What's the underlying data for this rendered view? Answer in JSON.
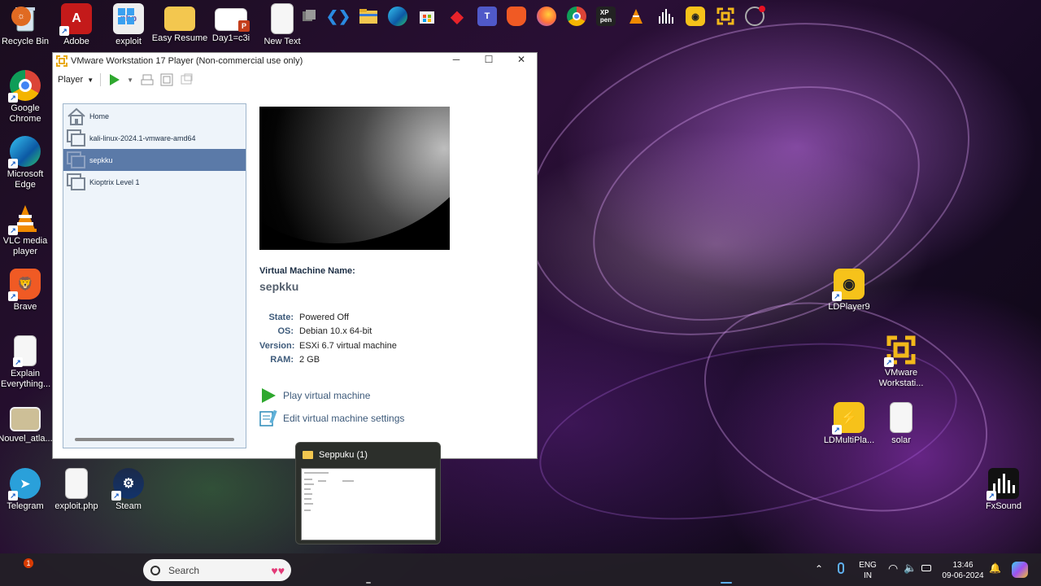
{
  "desktop": {
    "icons_left": [
      {
        "label": "Recycle Bin",
        "icon": "recycle-bin-icon"
      },
      {
        "label": "Adobe",
        "icon": "adobe-icon"
      },
      {
        "label": "exploit",
        "icon": "php-file-icon"
      },
      {
        "label": "Easy Resume",
        "icon": "folder-icon"
      },
      {
        "label": "Day1=c3i",
        "icon": "powerpoint-file-icon"
      },
      {
        "label": "New Text",
        "icon": "text-file-icon"
      },
      {
        "label": "Google Chrome",
        "icon": "chrome-icon"
      },
      {
        "label": "Microsoft Edge",
        "icon": "edge-icon"
      },
      {
        "label": "VLC media player",
        "icon": "vlc-icon"
      },
      {
        "label": "Brave",
        "icon": "brave-icon"
      },
      {
        "label": "Explain Everything...",
        "icon": "text-file-icon"
      },
      {
        "label": "Nouvel_atla...",
        "icon": "image-file-icon"
      },
      {
        "label": "Telegram",
        "icon": "telegram-icon"
      },
      {
        "label": "exploit.php",
        "icon": "text-file-icon"
      },
      {
        "label": "Steam",
        "icon": "steam-icon"
      }
    ],
    "icons_right": [
      {
        "label": "LDPlayer9",
        "icon": "ldplayer-icon"
      },
      {
        "label": "VMware Workstati...",
        "icon": "vmware-icon"
      },
      {
        "label": "LDMultiPla...",
        "icon": "ldmultiplayer-icon"
      },
      {
        "label": "solar",
        "icon": "text-file-icon"
      },
      {
        "label": "FxSound",
        "icon": "fxsound-icon"
      }
    ]
  },
  "vmware": {
    "title": "VMware Workstation 17 Player (Non-commercial use only)",
    "menu_label": "Player",
    "library": [
      {
        "label": "Home",
        "selected": false
      },
      {
        "label": "kali-linux-2024.1-vmware-amd64",
        "selected": false
      },
      {
        "label": "sepkku",
        "selected": true
      },
      {
        "label": "Kioptrix Level 1",
        "selected": false
      }
    ],
    "details": {
      "name_heading": "Virtual Machine Name:",
      "name": "sepkku",
      "state_label": "State:",
      "state": "Powered Off",
      "os_label": "OS:",
      "os": "Debian 10.x 64-bit",
      "version_label": "Version:",
      "version": "ESXi 6.7 virtual machine",
      "ram_label": "RAM:",
      "ram": "2 GB"
    },
    "actions": {
      "play": "Play virtual machine",
      "edit": "Edit virtual machine settings"
    }
  },
  "preview": {
    "title": "Seppuku (1)"
  },
  "taskbar": {
    "search_placeholder": "Search",
    "notification_badge": "1",
    "language_line1": "ENG",
    "language_line2": "IN",
    "time": "13:46",
    "date": "09-06-2024"
  },
  "colors": {
    "accent_selected": "#5b7aa8",
    "label_blue": "#3d5a7a",
    "play_green": "#2fa82f"
  }
}
